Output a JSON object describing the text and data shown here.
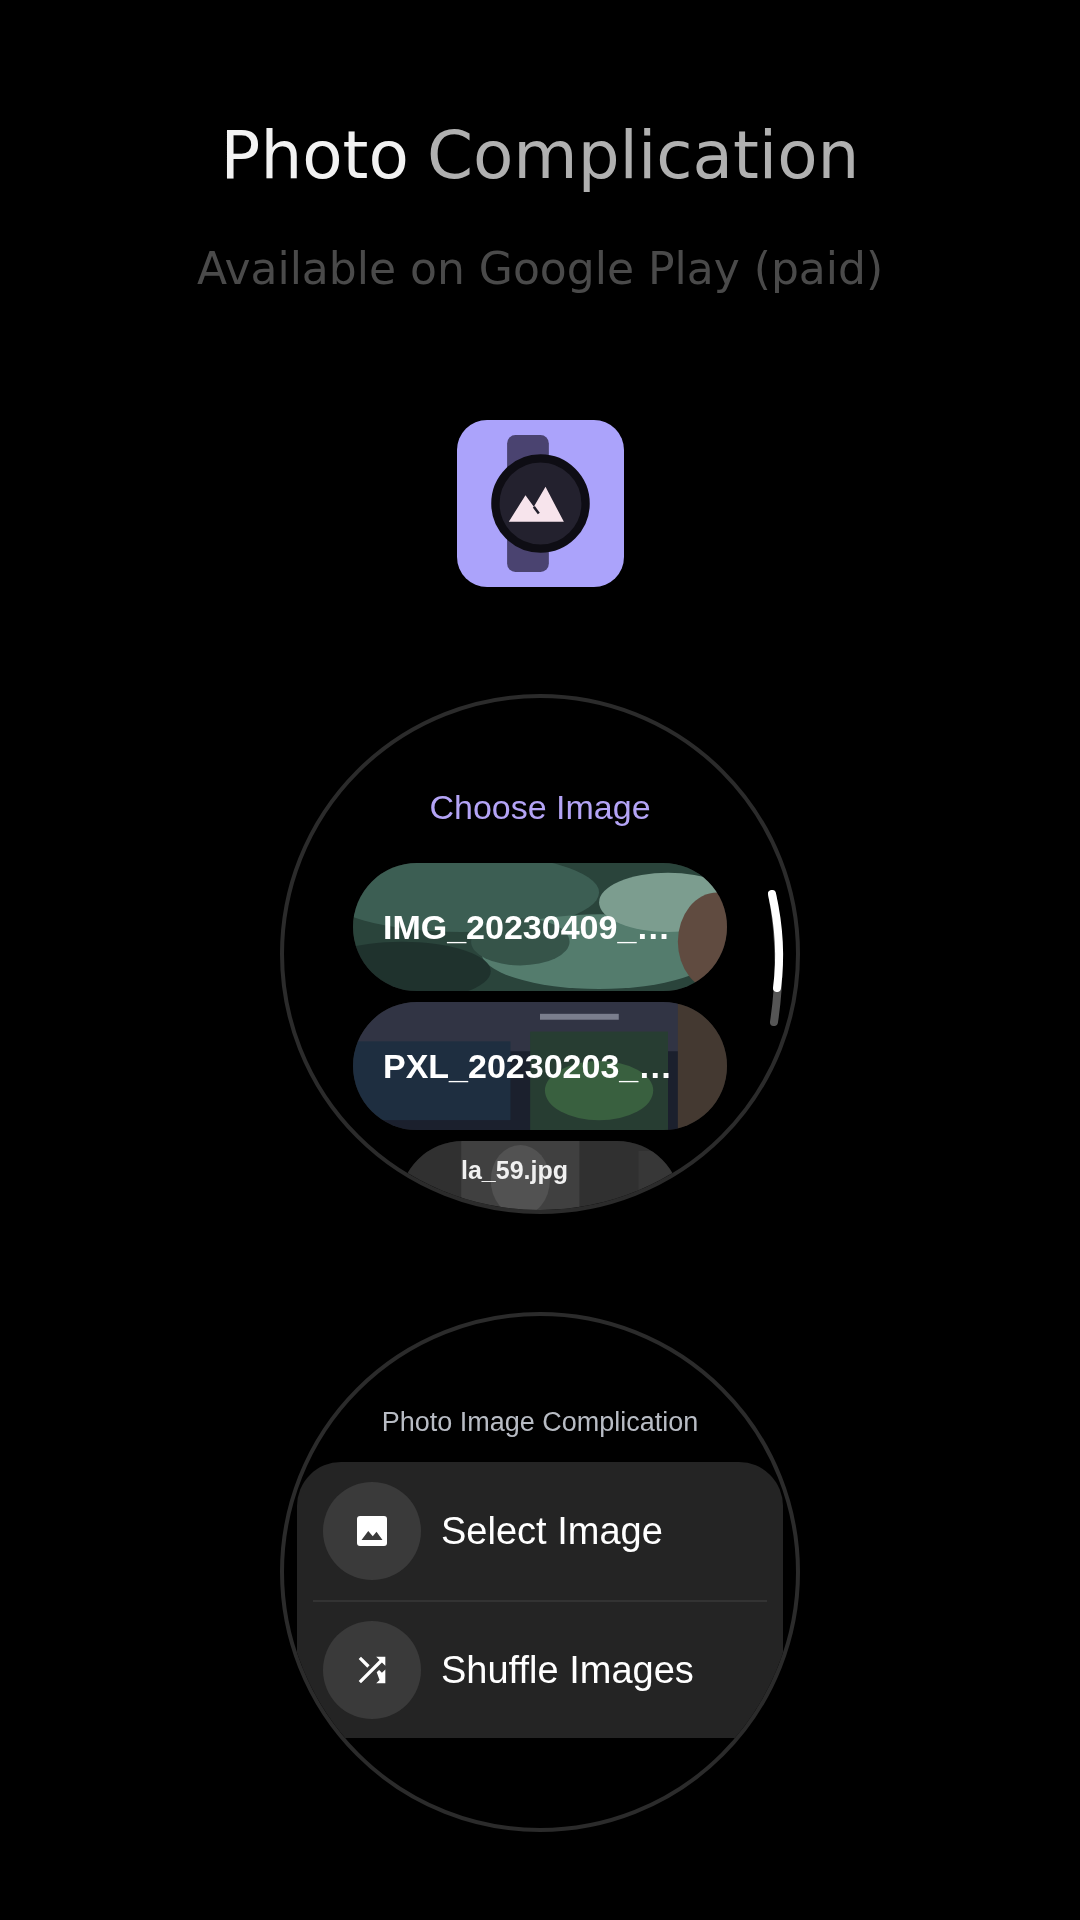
{
  "header": {
    "title_lead": "Photo",
    "title_rest": "Complication",
    "subtitle": "Available on Google Play (paid)"
  },
  "chooser_screen": {
    "title": "Choose Image",
    "images": [
      {
        "name": "IMG_20230409_…"
      },
      {
        "name": "PXL_20230203_…"
      },
      {
        "name": "la_59.jpg"
      }
    ]
  },
  "complication_screen": {
    "title": "Photo Image Complication",
    "actions": [
      {
        "kind": "select",
        "label": "Select Image"
      },
      {
        "kind": "shuffle",
        "label": "Shuffle Images"
      }
    ]
  }
}
